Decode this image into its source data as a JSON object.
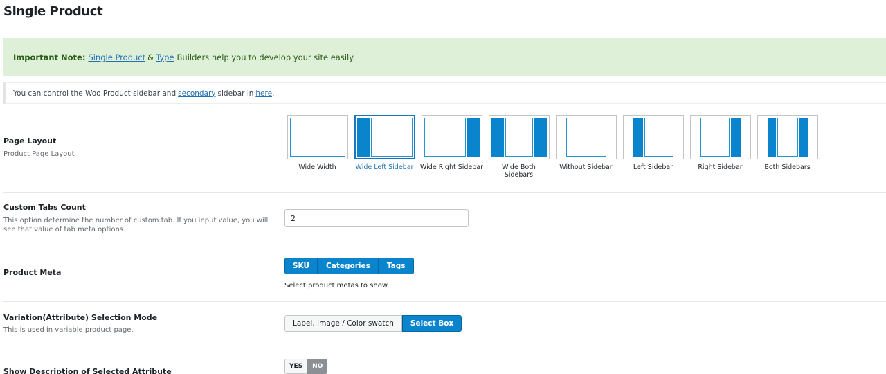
{
  "page": {
    "title": "Single Product"
  },
  "notice": {
    "strong": "Important Note:",
    "link1": "Single Product",
    "amp": "&",
    "link2": "Type",
    "rest": "Builders help you to develop your site easily."
  },
  "info": {
    "text1": "You can control the Woo Product sidebar and",
    "link1": "secondary",
    "text2": "sidebar in",
    "link2": "here",
    "text3": "."
  },
  "page_layout": {
    "label": "Page Layout",
    "description": "Product Page Layout",
    "selected": "Wide Left Sidebar",
    "options": [
      {
        "label": "Wide Width"
      },
      {
        "label": "Wide Left Sidebar"
      },
      {
        "label": "Wide Right Sidebar"
      },
      {
        "label": "Wide Both Sidebars"
      },
      {
        "label": "Without Sidebar"
      },
      {
        "label": "Left Sidebar"
      },
      {
        "label": "Right Sidebar"
      },
      {
        "label": "Both Sidebars"
      }
    ]
  },
  "custom_tabs": {
    "label": "Custom Tabs Count",
    "description": "This option determine the number of custom tab. If you input value, you will see that value of tab meta options.",
    "value": "2"
  },
  "product_meta": {
    "label": "Product Meta",
    "buttons": [
      "SKU",
      "Categories",
      "Tags"
    ],
    "hint": "Select product metas to show."
  },
  "variation_mode": {
    "label": "Variation(Attribute) Selection Mode",
    "description": "This is used in variable product page.",
    "options": [
      "Label, Image / Color swatch",
      "Select Box"
    ],
    "selected": "Select Box"
  },
  "show_description": {
    "label": "Show Description of Selected Attribute",
    "yes": "YES",
    "no": "NO",
    "selected": "NO"
  },
  "colors": {
    "accent": "#0a84cc",
    "notice_bg": "#dff0d8",
    "link": "#2271b1"
  }
}
